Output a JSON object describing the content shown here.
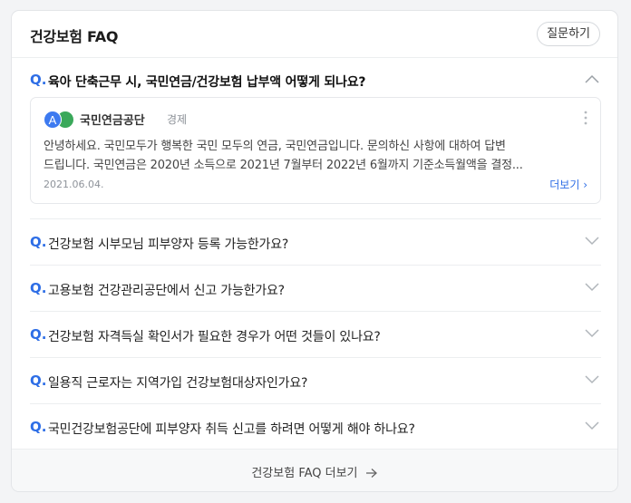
{
  "header": {
    "title": "건강보험 FAQ",
    "ask_button": "질문하기"
  },
  "faq": [
    {
      "mark": "Q.",
      "question": "육아 단축근무 시, 국민연금/건강보험 납부액 어떻게 되나요?",
      "expanded": true,
      "chevron": "chevron-up-icon"
    },
    {
      "mark": "Q.",
      "question": "건강보험 시부모님 피부양자 등록 가능한가요?",
      "expanded": false,
      "chevron": "chevron-down-icon"
    },
    {
      "mark": "Q.",
      "question": "고용보험 건강관리공단에서 신고 가능한가요?",
      "expanded": false,
      "chevron": "chevron-down-icon"
    },
    {
      "mark": "Q.",
      "question": "건강보험 자격득실 확인서가 필요한 경우가 어떤 것들이 있나요?",
      "expanded": false,
      "chevron": "chevron-down-icon"
    },
    {
      "mark": "Q.",
      "question": "일용직 근로자는 지역가입 건강보험대상자인가요?",
      "expanded": false,
      "chevron": "chevron-down-icon"
    },
    {
      "mark": "Q.",
      "question": "국민건강보험공단에 피부양자 취득 신고를 하려면 어떻게 해야 하나요?",
      "expanded": false,
      "chevron": "chevron-down-icon"
    }
  ],
  "answer": {
    "logo_letter": "A",
    "source_name": "국민연금공단",
    "category": "경제",
    "line1": "안녕하세요. 국민모두가 행복한 국민 모두의 연금, 국민연금입니다. 문의하신 사항에 대하여 답변",
    "line2": "드립니다. 국민연금은 2020년 소득으로 2021년 7월부터 2022년 6월까지 기준소득월액을 결정...",
    "date": "2021.06.04.",
    "more_label": "더보기 ›"
  },
  "footer": {
    "label": "건강보험 FAQ 더보기"
  },
  "colors": {
    "accent": "#2e6ee6",
    "logo_blue": "#3d7af0",
    "logo_green": "#3aa85a"
  }
}
